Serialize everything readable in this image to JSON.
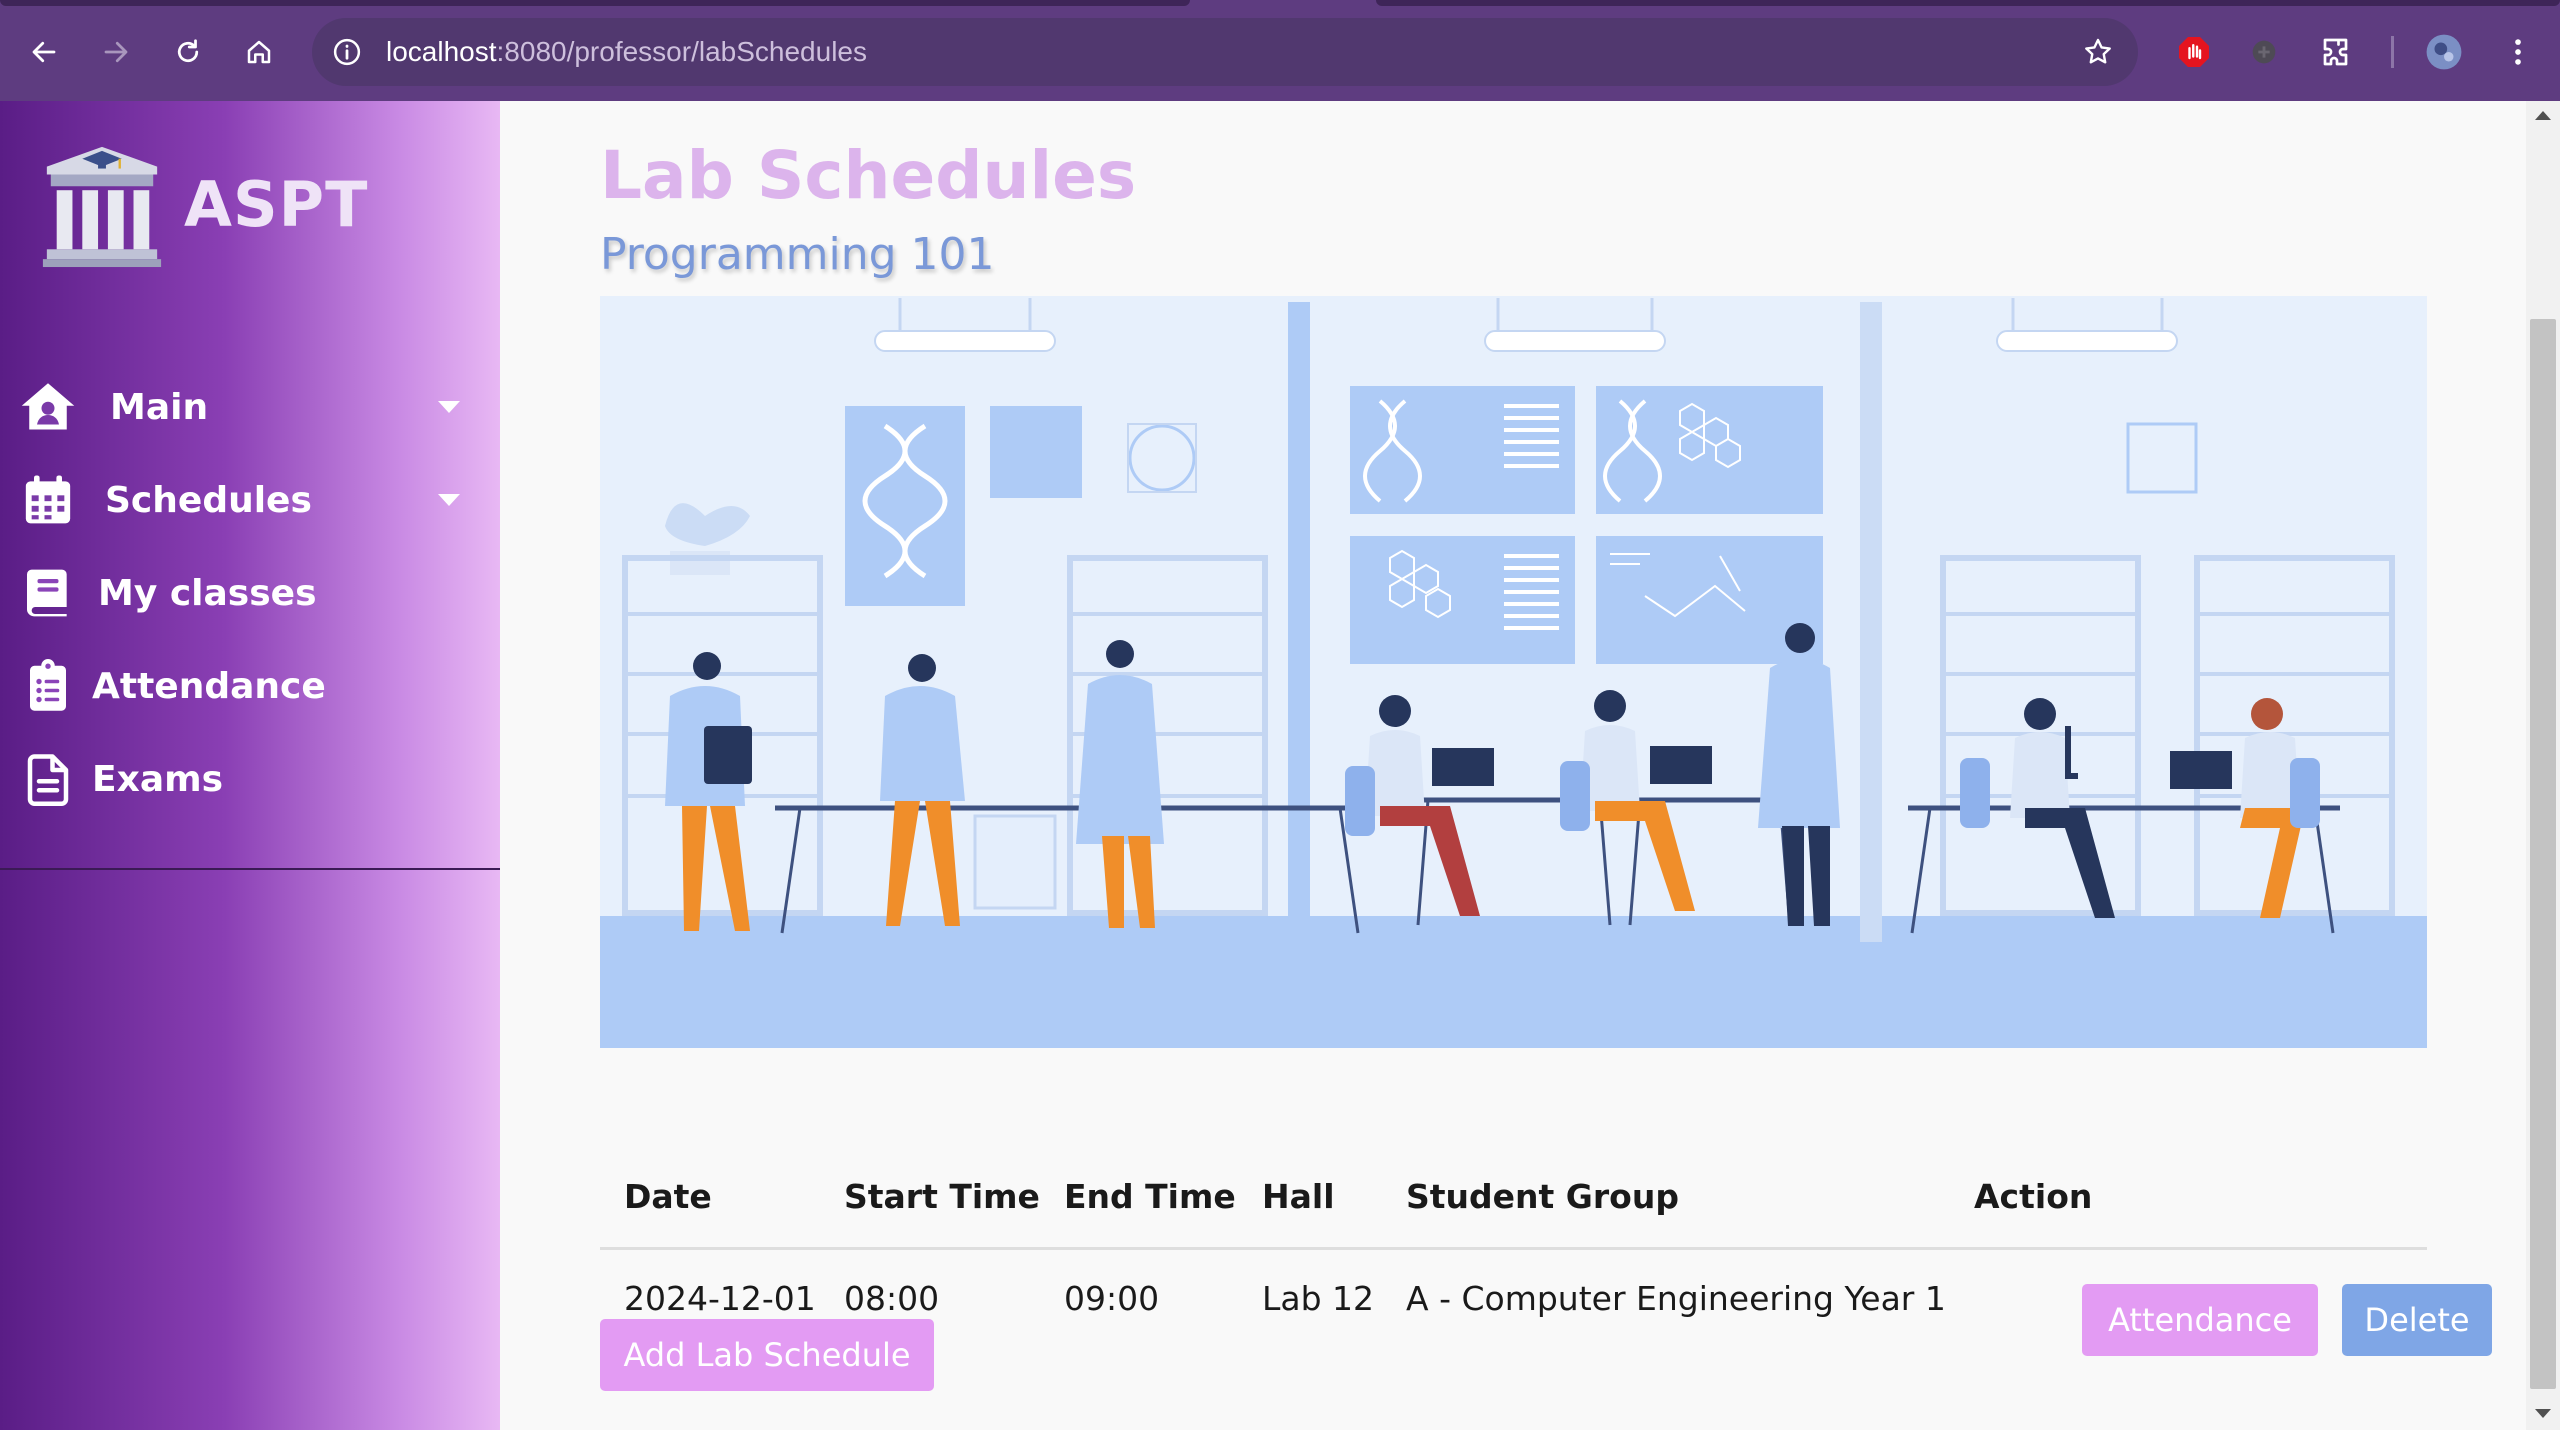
{
  "browser": {
    "url_host": "localhost",
    "url_path": ":8080/professor/labSchedules"
  },
  "sidebar": {
    "brand": "ASPT",
    "items": [
      {
        "label": "Main",
        "icon": "home-icon",
        "has_caret": true
      },
      {
        "label": "Schedules",
        "icon": "calendar-icon",
        "has_caret": true
      },
      {
        "label": "My classes",
        "icon": "book-icon",
        "has_caret": false
      },
      {
        "label": "Attendance",
        "icon": "clipboard-list-icon",
        "has_caret": false
      },
      {
        "label": "Exams",
        "icon": "document-icon",
        "has_caret": false
      }
    ]
  },
  "main": {
    "title": "Lab Schedules",
    "subtitle": "Programming 101",
    "banner_icon": "laboratory-illustration",
    "table": {
      "headers": [
        "Date",
        "Start Time",
        "End Time",
        "Hall",
        "Student Group",
        "Action"
      ],
      "rows": [
        {
          "date": "2024-12-01",
          "start_time": "08:00",
          "end_time": "09:00",
          "hall": "Lab 12",
          "student_group": "A - Computer Engineering Year 1",
          "actions": {
            "attendance": "Attendance",
            "delete": "Delete"
          }
        }
      ]
    },
    "add_button": "Add Lab Schedule"
  },
  "colors": {
    "browser_chrome": "#5e3c80",
    "sidebar_gradient_start": "#5a1d86",
    "sidebar_gradient_end": "#e8b8f4",
    "title": "#dcb4ec",
    "subtitle": "#7a98d8",
    "attendance_button": "#e39bf3",
    "delete_button": "#7fa6e6"
  }
}
